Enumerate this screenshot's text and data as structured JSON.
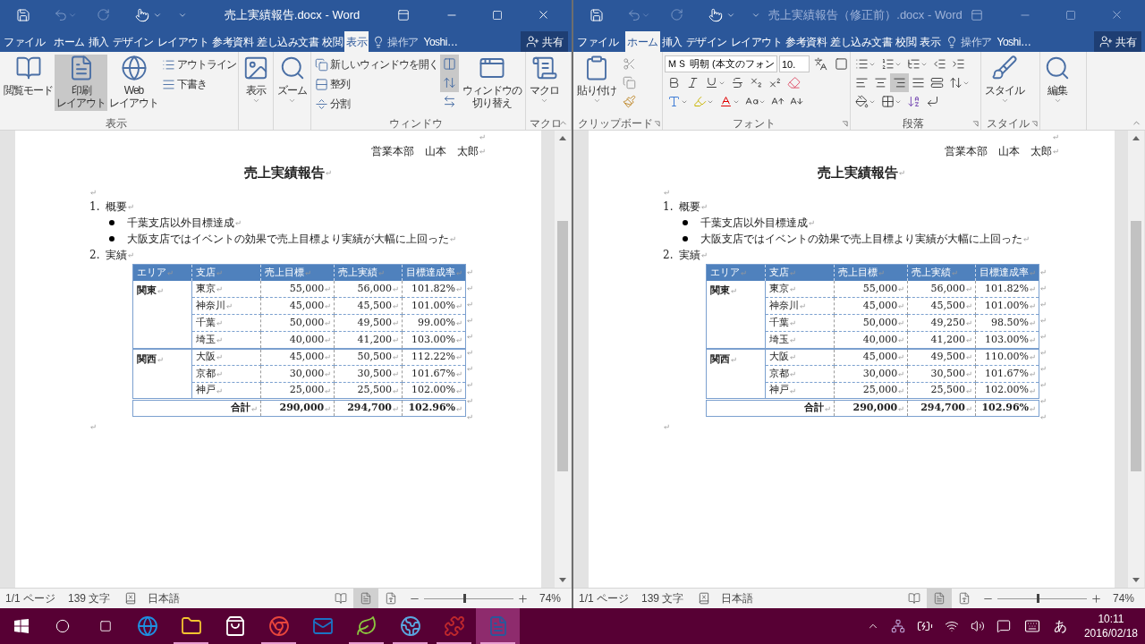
{
  "windows": [
    {
      "title": "売上実績報告.docx - Word",
      "active": true,
      "formatting_marks": true,
      "tabs": [
        {
          "label": "ファイル",
          "selected": false
        },
        {
          "label": "ホーム",
          "selected": false
        },
        {
          "label": "挿入",
          "selected": false
        },
        {
          "label": "デザイン",
          "selected": false
        },
        {
          "label": "レイアウト",
          "selected": false
        },
        {
          "label": "参考資料",
          "selected": false
        },
        {
          "label": "差し込み文書",
          "selected": false
        },
        {
          "label": "校閲",
          "selected": false
        },
        {
          "label": "表示",
          "selected": true
        }
      ],
      "tell_me": "操作ア",
      "user": "Yoshi…",
      "share": "共有",
      "ribbon": {
        "kind": "view",
        "views": {
          "label": "表示",
          "modes": [
            {
              "label_lines": [
                "閲覧モード"
              ],
              "selected": false
            },
            {
              "label_lines": [
                "印刷",
                "レイアウト"
              ],
              "selected": true
            },
            {
              "label_lines": [
                "Web",
                "レイアウト"
              ],
              "selected": false
            }
          ],
          "drafts": [
            "アウトライン",
            "下書き"
          ]
        },
        "show": "表示",
        "zoom": "ズーム",
        "window": {
          "label": "ウィンドウ",
          "commands": [
            "新しいウィンドウを開く",
            "整列",
            "分割"
          ],
          "toggles": [
            {
              "selected": true
            },
            {
              "selected": true
            },
            {
              "selected": false
            }
          ],
          "switch_lines": [
            "ウィンドウの",
            "切り替え"
          ]
        },
        "macro": {
          "label": "マクロ",
          "button": "マクロ"
        }
      },
      "document": {
        "author": "営業本部　山本　太郎",
        "title": "売上実績報告",
        "sections": [
          {
            "number": "1.",
            "heading": "概要",
            "bullets": [
              "千葉支店以外目標達成",
              "大阪支店ではイベントの効果で売上目標より実績が大幅に上回った"
            ]
          },
          {
            "number": "2.",
            "heading": "実績"
          }
        ],
        "table": {
          "columns": [
            "エリア",
            "支店",
            "売上目標",
            "売上実績",
            "目標達成率"
          ],
          "groups": [
            {
              "area": "関東",
              "rows": [
                {
                  "branch": "東京",
                  "target": "55,000",
                  "actual": "56,000",
                  "rate": "101.82%"
                },
                {
                  "branch": "神奈川",
                  "target": "45,000",
                  "actual": "45,500",
                  "rate": "101.00%"
                },
                {
                  "branch": "千葉",
                  "target": "50,000",
                  "actual": "49,500",
                  "rate": "99.00%"
                },
                {
                  "branch": "埼玉",
                  "target": "40,000",
                  "actual": "41,200",
                  "rate": "103.00%"
                }
              ]
            },
            {
              "area": "関西",
              "rows": [
                {
                  "branch": "大阪",
                  "target": "45,000",
                  "actual": "50,500",
                  "rate": "112.22%"
                },
                {
                  "branch": "京都",
                  "target": "30,000",
                  "actual": "30,500",
                  "rate": "101.67%"
                },
                {
                  "branch": "神戸",
                  "target": "25,000",
                  "actual": "25,500",
                  "rate": "102.00%"
                }
              ]
            }
          ],
          "total": {
            "label": "合計",
            "target": "290,000",
            "actual": "294,700",
            "rate": "102.96%"
          }
        }
      },
      "status_bar": {
        "page": "1/1 ページ",
        "words": "139 文字",
        "language": "日本語",
        "views": [
          {
            "selected": false
          },
          {
            "selected": true
          },
          {
            "selected": false
          }
        ],
        "zoom": {
          "level": 0.45,
          "reading": "74%"
        }
      }
    },
    {
      "title": "売上実績報告（修正前）.docx - Word",
      "active": false,
      "formatting_marks": true,
      "tabs": [
        {
          "label": "ファイル",
          "selected": false
        },
        {
          "label": "ホーム",
          "selected": true
        },
        {
          "label": "挿入",
          "selected": false
        },
        {
          "label": "デザイン",
          "selected": false
        },
        {
          "label": "レイアウト",
          "selected": false
        },
        {
          "label": "参考資料",
          "selected": false
        },
        {
          "label": "差し込み文書",
          "selected": false
        },
        {
          "label": "校閲",
          "selected": false
        },
        {
          "label": "表示",
          "selected": false
        }
      ],
      "tell_me": "操作ア",
      "user": "Yoshi…",
      "share": "共有",
      "ribbon": {
        "kind": "home",
        "clipboard": {
          "label": "クリップボード",
          "paste": "貼り付け"
        },
        "font": {
          "label": "フォント",
          "name": "ＭＳ 明朝 (本文のフォン",
          "size": "10."
        },
        "paragraph": {
          "label": "段落",
          "alignment": [
            {
              "selected": false
            },
            {
              "selected": false
            },
            {
              "selected": true
            },
            {
              "selected": false
            },
            {
              "selected": false
            }
          ]
        },
        "styles": {
          "label": "スタイル",
          "button": "スタイル"
        },
        "editing": "編集"
      },
      "document": {
        "author": "営業本部　山本　太郎",
        "title": "売上実績報告",
        "sections": [
          {
            "number": "1.",
            "heading": "概要",
            "bullets": [
              "千葉支店以外目標達成",
              "大阪支店ではイベントの効果で売上目標より実績が大幅に上回った"
            ]
          },
          {
            "number": "2.",
            "heading": "実績"
          }
        ],
        "table": {
          "columns": [
            "エリア",
            "支店",
            "売上目標",
            "売上実績",
            "目標達成率"
          ],
          "groups": [
            {
              "area": "関東",
              "rows": [
                {
                  "branch": "東京",
                  "target": "55,000",
                  "actual": "56,000",
                  "rate": "101.82%"
                },
                {
                  "branch": "神奈川",
                  "target": "45,000",
                  "actual": "45,500",
                  "rate": "101.00%"
                },
                {
                  "branch": "千葉",
                  "target": "50,000",
                  "actual": "49,250",
                  "rate": "98.50%"
                },
                {
                  "branch": "埼玉",
                  "target": "40,000",
                  "actual": "41,200",
                  "rate": "103.00%"
                }
              ]
            },
            {
              "area": "関西",
              "rows": [
                {
                  "branch": "大阪",
                  "target": "45,000",
                  "actual": "49,500",
                  "rate": "110.00%"
                },
                {
                  "branch": "京都",
                  "target": "30,000",
                  "actual": "30,500",
                  "rate": "101.67%"
                },
                {
                  "branch": "神戸",
                  "target": "25,000",
                  "actual": "25,500",
                  "rate": "102.00%"
                }
              ]
            }
          ],
          "total": {
            "label": "合計",
            "target": "290,000",
            "actual": "294,700",
            "rate": "102.96%"
          }
        }
      },
      "status_bar": {
        "page": "1/1 ページ",
        "words": "139 文字",
        "language": "日本語",
        "views": [
          {
            "selected": false
          },
          {
            "selected": true
          },
          {
            "selected": false
          }
        ],
        "zoom": {
          "level": 0.45,
          "reading": "74%"
        }
      }
    }
  ],
  "taskbar": {
    "apps": [
      {
        "running": false,
        "selected": false
      },
      {
        "running": true,
        "selected": false
      },
      {
        "running": false,
        "selected": false
      },
      {
        "running": true,
        "selected": false
      },
      {
        "running": false,
        "selected": false
      },
      {
        "running": true,
        "selected": false
      },
      {
        "running": true,
        "selected": false
      },
      {
        "running": true,
        "selected": false
      },
      {
        "running": true,
        "selected": true
      }
    ],
    "ime": "あ",
    "time": "10:11",
    "date": "2016/02/18"
  }
}
